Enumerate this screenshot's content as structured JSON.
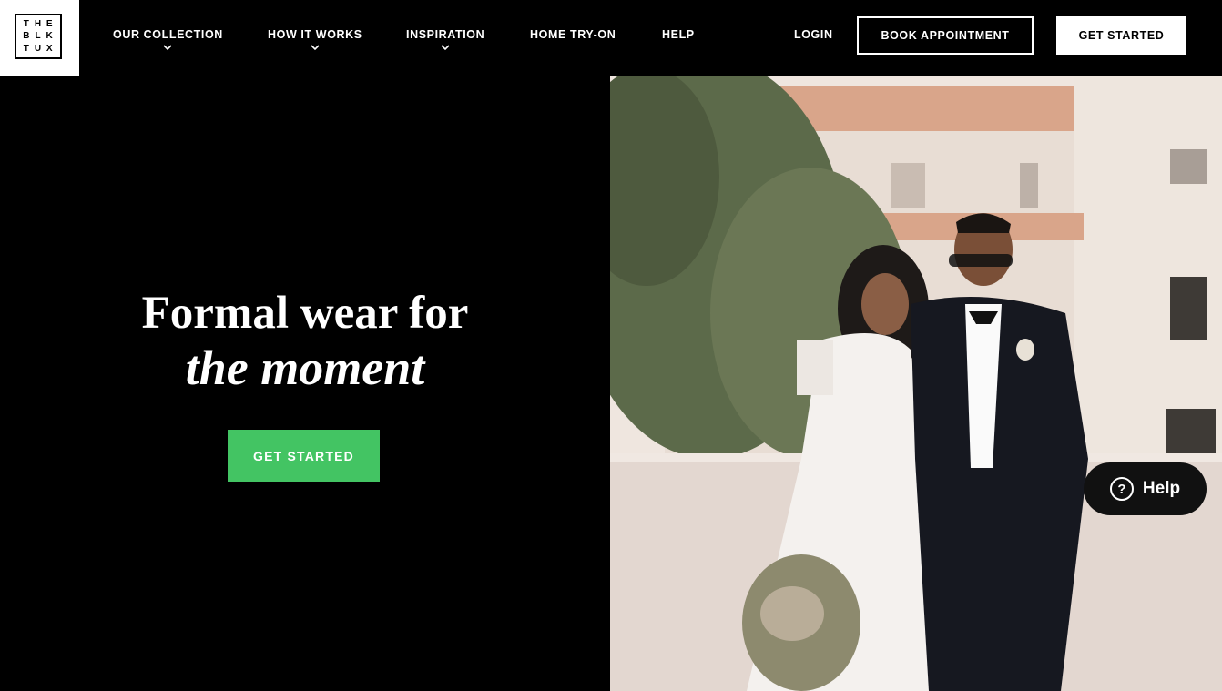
{
  "logo": {
    "letters": [
      "T",
      "H",
      "E",
      "B",
      "L",
      "K",
      "T",
      "U",
      "X"
    ],
    "alt": "THE BLK TUX"
  },
  "nav": {
    "items": [
      {
        "label": "OUR COLLECTION",
        "has_dropdown": true
      },
      {
        "label": "HOW IT WORKS",
        "has_dropdown": true
      },
      {
        "label": "INSPIRATION",
        "has_dropdown": true
      },
      {
        "label": "HOME TRY-ON",
        "has_dropdown": false
      },
      {
        "label": "HELP",
        "has_dropdown": false
      }
    ],
    "login": "LOGIN",
    "book_appointment": "BOOK APPOINTMENT",
    "get_started": "GET STARTED"
  },
  "hero": {
    "headline_line1": "Formal wear for",
    "headline_line2": "the moment",
    "cta": "GET STARTED",
    "image_desc": "couple-photo"
  },
  "help_widget": {
    "label": "Help",
    "icon": "question-icon"
  },
  "colors": {
    "accent_green": "#43c463",
    "background": "#000000",
    "text": "#ffffff"
  }
}
